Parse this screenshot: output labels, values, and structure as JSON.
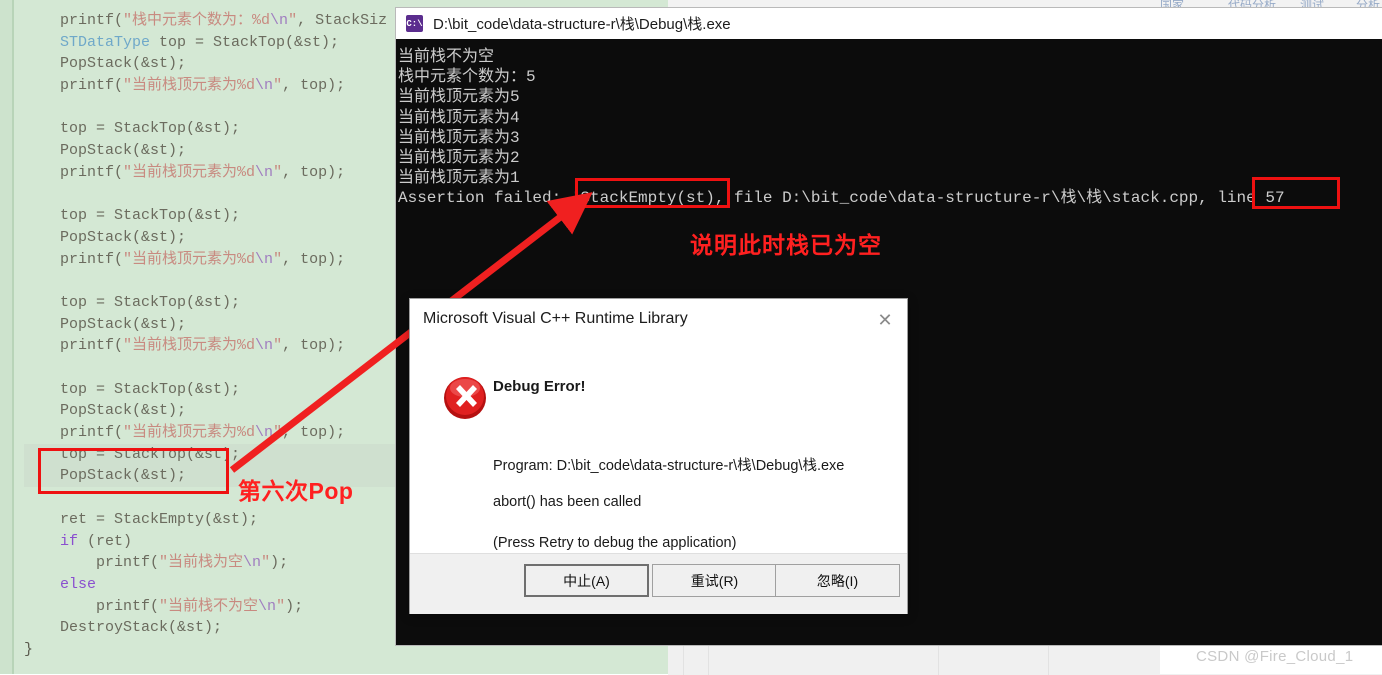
{
  "ide": {
    "menubar_fragments": [
      "国家",
      "代码分析",
      "测试",
      "分析"
    ],
    "bottom_watermark": "CSDN @Fire_Cloud_1"
  },
  "code_editor": {
    "language": "C",
    "background_color": "#d4e8d4",
    "lines": [
      {
        "indent": 1,
        "tokens": [
          {
            "t": "printf(",
            "c": "fn"
          },
          {
            "t": "\"栈中元素个数为：%d",
            "c": "str"
          },
          {
            "t": "\\n",
            "c": "esc"
          },
          {
            "t": "\"",
            "c": "str"
          },
          {
            "t": ", StackSiz",
            "c": "fn"
          }
        ]
      },
      {
        "indent": 1,
        "tokens": [
          {
            "t": "STDataType",
            "c": "typ"
          },
          {
            "t": " top = StackTop(&st);",
            "c": "fn"
          }
        ]
      },
      {
        "indent": 1,
        "tokens": [
          {
            "t": "PopStack(&st);",
            "c": "fn"
          }
        ]
      },
      {
        "indent": 1,
        "tokens": [
          {
            "t": "printf(",
            "c": "fn"
          },
          {
            "t": "\"当前栈顶元素为%d",
            "c": "str"
          },
          {
            "t": "\\n",
            "c": "esc"
          },
          {
            "t": "\"",
            "c": "str"
          },
          {
            "t": ", top);",
            "c": "fn"
          }
        ]
      },
      {
        "indent": 0,
        "tokens": []
      },
      {
        "indent": 1,
        "tokens": [
          {
            "t": "top = StackTop(&st);",
            "c": "fn"
          }
        ]
      },
      {
        "indent": 1,
        "tokens": [
          {
            "t": "PopStack(&st);",
            "c": "fn"
          }
        ]
      },
      {
        "indent": 1,
        "tokens": [
          {
            "t": "printf(",
            "c": "fn"
          },
          {
            "t": "\"当前栈顶元素为%d",
            "c": "str"
          },
          {
            "t": "\\n",
            "c": "esc"
          },
          {
            "t": "\"",
            "c": "str"
          },
          {
            "t": ", top);",
            "c": "fn"
          }
        ]
      },
      {
        "indent": 0,
        "tokens": []
      },
      {
        "indent": 1,
        "tokens": [
          {
            "t": "top = StackTop(&st);",
            "c": "fn"
          }
        ]
      },
      {
        "indent": 1,
        "tokens": [
          {
            "t": "PopStack(&st);",
            "c": "fn"
          }
        ]
      },
      {
        "indent": 1,
        "tokens": [
          {
            "t": "printf(",
            "c": "fn"
          },
          {
            "t": "\"当前栈顶元素为%d",
            "c": "str"
          },
          {
            "t": "\\n",
            "c": "esc"
          },
          {
            "t": "\"",
            "c": "str"
          },
          {
            "t": ", top);",
            "c": "fn"
          }
        ]
      },
      {
        "indent": 0,
        "tokens": []
      },
      {
        "indent": 1,
        "tokens": [
          {
            "t": "top = StackTop(&st);",
            "c": "fn"
          }
        ]
      },
      {
        "indent": 1,
        "tokens": [
          {
            "t": "PopStack(&st);",
            "c": "fn"
          }
        ]
      },
      {
        "indent": 1,
        "tokens": [
          {
            "t": "printf(",
            "c": "fn"
          },
          {
            "t": "\"当前栈顶元素为%d",
            "c": "str"
          },
          {
            "t": "\\n",
            "c": "esc"
          },
          {
            "t": "\"",
            "c": "str"
          },
          {
            "t": ", top);",
            "c": "fn"
          }
        ]
      },
      {
        "indent": 0,
        "tokens": []
      },
      {
        "indent": 1,
        "tokens": [
          {
            "t": "top = StackTop(&st);",
            "c": "fn"
          }
        ]
      },
      {
        "indent": 1,
        "tokens": [
          {
            "t": "PopStack(&st);",
            "c": "fn"
          }
        ]
      },
      {
        "indent": 1,
        "tokens": [
          {
            "t": "printf(",
            "c": "fn"
          },
          {
            "t": "\"当前栈顶元素为%d",
            "c": "str"
          },
          {
            "t": "\\n",
            "c": "esc"
          },
          {
            "t": "\"",
            "c": "str"
          },
          {
            "t": ", top);",
            "c": "fn"
          }
        ]
      },
      {
        "indent": 1,
        "selected": true,
        "tokens": [
          {
            "t": "top = StackTop(&st);",
            "c": "fn"
          }
        ]
      },
      {
        "indent": 1,
        "selected": true,
        "tokens": [
          {
            "t": "PopStack(&st);",
            "c": "fn"
          }
        ]
      },
      {
        "indent": 0,
        "tokens": []
      },
      {
        "indent": 1,
        "tokens": [
          {
            "t": "ret = StackEmpty(&st);",
            "c": "fn"
          }
        ]
      },
      {
        "indent": 1,
        "tokens": [
          {
            "t": "if",
            "c": "kw"
          },
          {
            "t": " (ret)",
            "c": "fn"
          }
        ]
      },
      {
        "indent": 2,
        "tokens": [
          {
            "t": "printf(",
            "c": "fn"
          },
          {
            "t": "\"当前栈为空",
            "c": "str"
          },
          {
            "t": "\\n",
            "c": "esc"
          },
          {
            "t": "\"",
            "c": "str"
          },
          {
            "t": ");",
            "c": "fn"
          }
        ]
      },
      {
        "indent": 1,
        "tokens": [
          {
            "t": "else",
            "c": "kw"
          }
        ]
      },
      {
        "indent": 2,
        "tokens": [
          {
            "t": "printf(",
            "c": "fn"
          },
          {
            "t": "\"当前栈不为空",
            "c": "str"
          },
          {
            "t": "\\n",
            "c": "esc"
          },
          {
            "t": "\"",
            "c": "str"
          },
          {
            "t": ");",
            "c": "fn"
          }
        ]
      },
      {
        "indent": 1,
        "tokens": [
          {
            "t": "DestroyStack(&st);",
            "c": "fn"
          }
        ]
      },
      {
        "indent": 0,
        "tokens": [
          {
            "t": "}",
            "c": "pl"
          }
        ]
      }
    ]
  },
  "console": {
    "icon_name": "console-app-icon",
    "icon_glyph": "C:\\",
    "title": "D:\\bit_code\\data-structure-r\\栈\\Debug\\栈.exe",
    "background_color": "#0c0c0c",
    "text_color": "#cccccc",
    "output_lines": [
      "当前栈不为空",
      "栈中元素个数为：5",
      "当前栈顶元素为5",
      "当前栈顶元素为4",
      "当前栈顶元素为3",
      "当前栈顶元素为2",
      "当前栈顶元素为1",
      "Assertion failed: !StackEmpty(st), file D:\\bit_code\\data-structure-r\\栈\\栈\\stack.cpp, line 57"
    ]
  },
  "annotations": {
    "accent_color": "#ee1111",
    "highlight_assert_expression": "!StackEmpty(st)",
    "highlight_line_number": "line 57",
    "note_stack_empty": "说明此时栈已为空",
    "note_sixth_pop": "第六次Pop"
  },
  "dialog": {
    "title": "Microsoft Visual C++ Runtime Library",
    "close_label": "✕",
    "icon_name": "error-icon",
    "heading": "Debug Error!",
    "program_line": "Program: D:\\bit_code\\data-structure-r\\栈\\Debug\\栈.exe",
    "abort_line": "abort() has been called",
    "retry_hint": "(Press Retry to debug the application)",
    "buttons": [
      {
        "label": "中止(A)",
        "name": "abort-button",
        "default": true
      },
      {
        "label": "重试(R)",
        "name": "retry-button",
        "default": false
      },
      {
        "label": "忽略(I)",
        "name": "ignore-button",
        "default": false
      }
    ]
  }
}
